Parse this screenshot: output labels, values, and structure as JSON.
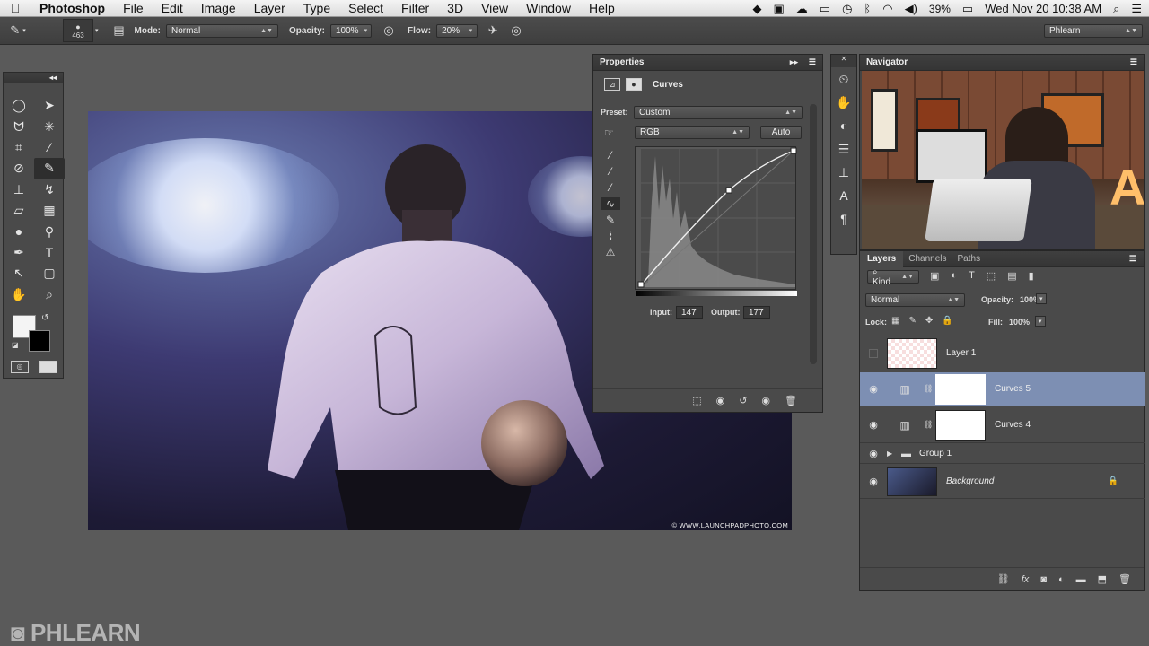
{
  "menubar": {
    "apple": "",
    "app_name": "Photoshop",
    "items": [
      "File",
      "Edit",
      "Image",
      "Layer",
      "Type",
      "Select",
      "Filter",
      "3D",
      "View",
      "Window",
      "Help"
    ],
    "battery": "39%",
    "clock": "Wed Nov 20  10:38 AM"
  },
  "options": {
    "brush_size": "463",
    "mode_label": "Mode:",
    "mode_value": "Normal",
    "opacity_label": "Opacity:",
    "opacity_value": "100%",
    "flow_label": "Flow:",
    "flow_value": "20%",
    "workspace": "Phlearn"
  },
  "canvas": {
    "copyright": "© WWW.LAUNCHPADPHOTO.COM"
  },
  "properties": {
    "title": "Properties",
    "panel_type": "Curves",
    "preset_label": "Preset:",
    "preset_value": "Custom",
    "channel_value": "RGB",
    "auto_label": "Auto",
    "input_label": "Input:",
    "input_value": "147",
    "output_label": "Output:",
    "output_value": "177"
  },
  "navigator": {
    "title": "Navigator"
  },
  "layers": {
    "tabs": [
      "Layers",
      "Channels",
      "Paths"
    ],
    "kind_label": "Kind",
    "blend_mode": "Normal",
    "opacity_label": "Opacity:",
    "opacity_value": "100%",
    "lock_label": "Lock:",
    "fill_label": "Fill:",
    "fill_value": "100%",
    "items": [
      {
        "name": "Layer 1"
      },
      {
        "name": "Curves 5"
      },
      {
        "name": "Curves 4"
      },
      {
        "name": "Group 1"
      },
      {
        "name": "Background"
      }
    ]
  },
  "watermark": {
    "text": "PHLEARN"
  },
  "colors": {
    "selected_layer": "#7d8fb3",
    "panel_bg": "#4a4a4a"
  }
}
